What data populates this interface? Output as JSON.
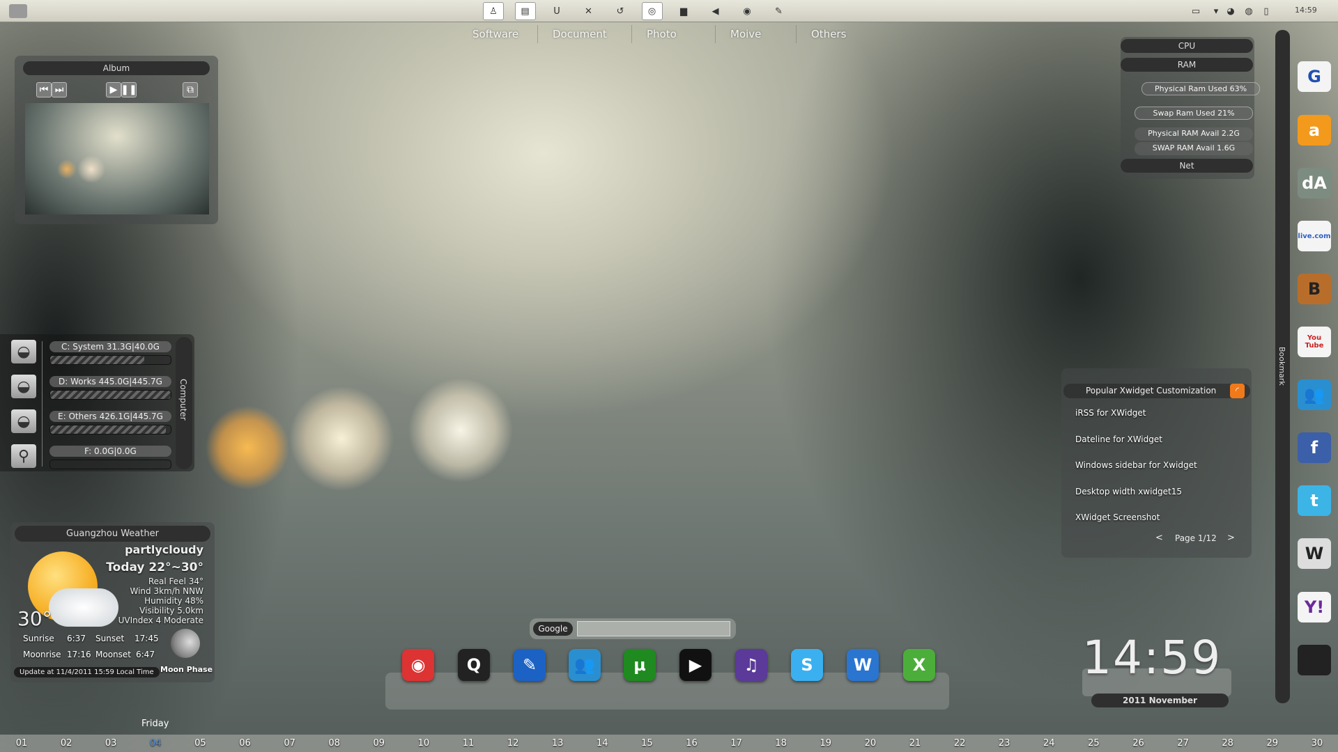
{
  "topbar": {
    "toolbar_icons": [
      "user-icon",
      "document-icon",
      "underline-icon",
      "tools-icon",
      "refresh-icon",
      "globe-icon",
      "stamp-icon",
      "back-icon",
      "media-icon",
      "script-icon"
    ],
    "tray_icons": [
      "printer-icon",
      "chevron-down-icon",
      "qq-icon",
      "firefox-icon",
      "network-icon"
    ],
    "clock": "14:59"
  },
  "tabs": [
    "Software",
    "Document",
    "Photo",
    "Moive",
    "Others"
  ],
  "album": {
    "title": "Album"
  },
  "system": {
    "cpu": "CPU",
    "ram": "RAM",
    "rows": [
      "Physical Ram Used   63%",
      "Swap Ram Used   21%",
      "Physical RAM Avail 2.2G",
      "SWAP RAM Avail    1.6G"
    ],
    "net": "Net",
    "physical_used_pct": 63,
    "swap_used_pct": 21
  },
  "drives": {
    "side_label": "Computer",
    "items": [
      {
        "label": "C:  System   31.3G|40.0G",
        "icon": "hard-drive-icon",
        "used_pct": 78
      },
      {
        "label": "D:  Works   445.0G|445.7G",
        "icon": "hard-drive-icon",
        "used_pct": 100
      },
      {
        "label": "E:  Others   426.1G|445.7G",
        "icon": "hard-drive-icon",
        "used_pct": 96
      },
      {
        "label": "F:      0.0G|0.0G",
        "icon": "usb-icon",
        "used_pct": 0
      }
    ]
  },
  "weather": {
    "title": "Guangzhou Weather",
    "condition": "partlycloudy",
    "today": "Today 22°~30°",
    "details": [
      "Real Feel 34°",
      "Wind 3km/h NNW",
      "Humidity 48%",
      "Visibility 5.0km",
      "UVIndex 4 Moderate"
    ],
    "temp": "30°",
    "sunrise_label": "Sunrise",
    "sunrise": "6:37",
    "sunset_label": "Sunset",
    "sunset": "17:45",
    "moonrise_label": "Moonrise",
    "moonrise": "17:16",
    "moonset_label": "Moonset",
    "moonset": "6:47",
    "moon_phase": "Moon Phase",
    "update": "Update at 11/4/2011 15:59 Local Time"
  },
  "dateline": {
    "weekday": "Friday",
    "days": [
      "01",
      "02",
      "03",
      "04",
      "05",
      "06",
      "07",
      "08",
      "09",
      "10",
      "11",
      "12",
      "13",
      "14",
      "15",
      "16",
      "17",
      "18",
      "19",
      "20",
      "21",
      "22",
      "23",
      "24",
      "25",
      "26",
      "27",
      "28",
      "29",
      "30"
    ],
    "today": "04",
    "accent": "#4a8fe0"
  },
  "search": {
    "engine": "Google",
    "value": ""
  },
  "dock": [
    {
      "name": "chrome",
      "glyph": "◉",
      "color": "#d33"
    },
    {
      "name": "quicktime",
      "glyph": "Q",
      "color": "#222"
    },
    {
      "name": "paint",
      "glyph": "✎",
      "color": "#1b62c4"
    },
    {
      "name": "messenger",
      "glyph": "👥",
      "color": "#2a8fd0"
    },
    {
      "name": "utorrent",
      "glyph": "µ",
      "color": "#1f8a1f"
    },
    {
      "name": "media-player",
      "glyph": "▶",
      "color": "#111"
    },
    {
      "name": "itunes",
      "glyph": "♫",
      "color": "#5b3a9a"
    },
    {
      "name": "skype",
      "glyph": "S",
      "color": "#3ab0f0"
    },
    {
      "name": "word",
      "glyph": "W",
      "color": "#2a75d0"
    },
    {
      "name": "excel",
      "glyph": "X",
      "color": "#4cae3a"
    }
  ],
  "rss": {
    "title": "Popular Xwidget Customization",
    "items": [
      "iRSS for XWidget",
      "Dateline for XWidget",
      "Windows sidebar for Xwidget",
      "Desktop width xwidget15",
      "XWidget Screenshot"
    ],
    "prev": "<",
    "page": "Page 1/12",
    "next": ">",
    "accent": "#f07a1a"
  },
  "clock": {
    "time": "14:59",
    "date": "2011  November"
  },
  "bookmarks": {
    "label": "Bookmark",
    "items": [
      {
        "name": "google",
        "glyph": "G",
        "bg": "#f4f4f4",
        "fg": "#2050b0"
      },
      {
        "name": "amazon",
        "glyph": "a",
        "bg": "#f39a1c",
        "fg": "#fff"
      },
      {
        "name": "deviantart",
        "glyph": "dA",
        "bg": "#7d8c80",
        "fg": "#fff"
      },
      {
        "name": "live",
        "glyph": "live.com",
        "bg": "#f4f4f4",
        "fg": "#3060c0"
      },
      {
        "name": "blogger",
        "glyph": "B",
        "bg": "#b86e2a",
        "fg": "#222"
      },
      {
        "name": "youtube",
        "glyph": "You Tube",
        "bg": "#f4f4f4",
        "fg": "#c22"
      },
      {
        "name": "messenger",
        "glyph": "👥",
        "bg": "#2a8fd0",
        "fg": "#fff"
      },
      {
        "name": "facebook",
        "glyph": "f",
        "bg": "#3b5fa8",
        "fg": "#fff"
      },
      {
        "name": "twitter",
        "glyph": "t",
        "bg": "#3cb4e6",
        "fg": "#fff"
      },
      {
        "name": "wikipedia",
        "glyph": "W",
        "bg": "#ddd",
        "fg": "#222"
      },
      {
        "name": "yahoo",
        "glyph": "Y!",
        "bg": "#f4f4f4",
        "fg": "#6a2a9a"
      },
      {
        "name": "apple",
        "glyph": "",
        "bg": "#222",
        "fg": "#fff"
      }
    ]
  }
}
